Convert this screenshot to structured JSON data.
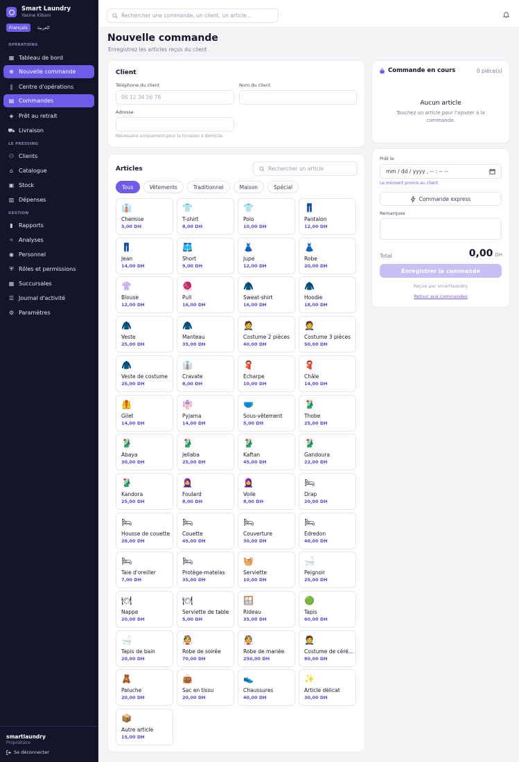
{
  "app": {
    "title": "Smart Laundry",
    "user": "Yasine Kibani",
    "languages": [
      "Français",
      "العربية"
    ]
  },
  "sidebar": {
    "sections": [
      {
        "label": "OPÉRATIONS",
        "items": [
          {
            "label": "Tableau de bord",
            "icon": "dashboard-icon"
          },
          {
            "label": "Nouvelle commande",
            "icon": "plus-circle-icon",
            "active": true
          },
          {
            "label": "Centre d'opérations",
            "icon": "kanban-icon"
          },
          {
            "label": "Commandes",
            "icon": "clipboard-icon",
            "active": true
          },
          {
            "label": "Prêt au retrait",
            "icon": "package-icon"
          },
          {
            "label": "Livraison",
            "icon": "truck-icon"
          }
        ]
      },
      {
        "label": "LE PRESSING",
        "items": [
          {
            "label": "Clients",
            "icon": "users-icon"
          },
          {
            "label": "Catalogue",
            "icon": "shirt-icon"
          },
          {
            "label": "Stock",
            "icon": "box-icon"
          },
          {
            "label": "Dépenses",
            "icon": "receipt-icon"
          }
        ]
      },
      {
        "label": "GESTION",
        "items": [
          {
            "label": "Rapports",
            "icon": "bar-chart-icon"
          },
          {
            "label": "Analyses",
            "icon": "lightbulb-icon"
          },
          {
            "label": "Personnel",
            "icon": "user-icon"
          },
          {
            "label": "Rôles et permissions",
            "icon": "shield-icon"
          },
          {
            "label": "Succursales",
            "icon": "building-icon"
          },
          {
            "label": "Journal d'activité",
            "icon": "journal-icon"
          },
          {
            "label": "Paramètres",
            "icon": "gear-icon"
          }
        ]
      }
    ],
    "footer": {
      "name": "smartlaundry",
      "role": "Propriétaire",
      "logout": "Se déconnecter"
    }
  },
  "topbar": {
    "search_placeholder": "Rechercher une commande, un client, un article..."
  },
  "page": {
    "title": "Nouvelle commande",
    "subtitle": "Enregistrez les articles reçus du client"
  },
  "client": {
    "title": "Client",
    "phone_label": "Téléphone du client",
    "phone_placeholder": "06 12 34 56 78",
    "name_label": "Nom du client",
    "name_value": "",
    "address_label": "Adresse",
    "address_value": "",
    "address_hint": "Nécessaire uniquement pour la livraison à domicile."
  },
  "articles": {
    "title": "Articles",
    "search_placeholder": "Rechercher un article",
    "filters": [
      "Tous",
      "Vêtements",
      "Traditionnel",
      "Maison",
      "Spécial"
    ],
    "active_filter": "Tous",
    "items": [
      {
        "name": "Chemise",
        "price": "5,00 DH",
        "icon": "👔"
      },
      {
        "name": "T-shirt",
        "price": "8,00 DH",
        "icon": "👕"
      },
      {
        "name": "Polo",
        "price": "10,00 DH",
        "icon": "👕"
      },
      {
        "name": "Pantalon",
        "price": "12,00 DH",
        "icon": "👖"
      },
      {
        "name": "Jean",
        "price": "14,00 DH",
        "icon": "👖"
      },
      {
        "name": "Short",
        "price": "9,00 DH",
        "icon": "🩳"
      },
      {
        "name": "Jupe",
        "price": "12,00 DH",
        "icon": "👗"
      },
      {
        "name": "Robe",
        "price": "20,00 DH",
        "icon": "👗"
      },
      {
        "name": "Blouse",
        "price": "12,00 DH",
        "icon": "👚"
      },
      {
        "name": "Pull",
        "price": "16,00 DH",
        "icon": "🧶"
      },
      {
        "name": "Sweat-shirt",
        "price": "16,00 DH",
        "icon": "🧥"
      },
      {
        "name": "Hoodie",
        "price": "18,00 DH",
        "icon": "🧥"
      },
      {
        "name": "Veste",
        "price": "25,00 DH",
        "icon": "🧥"
      },
      {
        "name": "Manteau",
        "price": "35,00 DH",
        "icon": "🧥"
      },
      {
        "name": "Costume 2 pièces",
        "price": "40,00 DH",
        "icon": "🤵"
      },
      {
        "name": "Costume 3 pièces",
        "price": "50,00 DH",
        "icon": "🤵"
      },
      {
        "name": "Veste de costume",
        "price": "25,00 DH",
        "icon": "🧥"
      },
      {
        "name": "Cravate",
        "price": "8,00 DH",
        "icon": "👔"
      },
      {
        "name": "Écharpe",
        "price": "10,00 DH",
        "icon": "🧣"
      },
      {
        "name": "Châle",
        "price": "14,00 DH",
        "icon": "🧣"
      },
      {
        "name": "Gilet",
        "price": "14,00 DH",
        "icon": "🦺"
      },
      {
        "name": "Pyjama",
        "price": "14,00 DH",
        "icon": "👘"
      },
      {
        "name": "Sous-vêtement",
        "price": "5,00 DH",
        "icon": "🩲"
      },
      {
        "name": "Thobe",
        "price": "25,00 DH",
        "icon": "🥻"
      },
      {
        "name": "Abaya",
        "price": "30,00 DH",
        "icon": "🥻"
      },
      {
        "name": "Jellaba",
        "price": "25,00 DH",
        "icon": "🥻"
      },
      {
        "name": "Kaftan",
        "price": "45,00 DH",
        "icon": "🥻"
      },
      {
        "name": "Gandoura",
        "price": "22,00 DH",
        "icon": "🥻"
      },
      {
        "name": "Kandora",
        "price": "25,00 DH",
        "icon": "🥻"
      },
      {
        "name": "Foulard",
        "price": "8,00 DH",
        "icon": "🧕"
      },
      {
        "name": "Voile",
        "price": "8,00 DH",
        "icon": "🧕"
      },
      {
        "name": "Drap",
        "price": "20,00 DH",
        "icon": "🛏"
      },
      {
        "name": "Housse de couette",
        "price": "28,00 DH",
        "icon": "🛏"
      },
      {
        "name": "Couette",
        "price": "45,00 DH",
        "icon": "🛏"
      },
      {
        "name": "Couverture",
        "price": "30,00 DH",
        "icon": "🛏"
      },
      {
        "name": "Édredon",
        "price": "40,00 DH",
        "icon": "🛏"
      },
      {
        "name": "Taie d'oreiller",
        "price": "7,00 DH",
        "icon": "🛏"
      },
      {
        "name": "Protège-matelas",
        "price": "35,00 DH",
        "icon": "🛏"
      },
      {
        "name": "Serviette",
        "price": "10,00 DH",
        "icon": "🧺"
      },
      {
        "name": "Peignoir",
        "price": "25,00 DH",
        "icon": "🛁"
      },
      {
        "name": "Nappe",
        "price": "20,00 DH",
        "icon": "🍽"
      },
      {
        "name": "Serviette de table",
        "price": "5,00 DH",
        "icon": "🍽"
      },
      {
        "name": "Rideau",
        "price": "35,00 DH",
        "icon": "🪟"
      },
      {
        "name": "Tapis",
        "price": "60,00 DH",
        "icon": "🟢"
      },
      {
        "name": "Tapis de bain",
        "price": "20,00 DH",
        "icon": "🛁"
      },
      {
        "name": "Robe de soirée",
        "price": "70,00 DH",
        "icon": "👰"
      },
      {
        "name": "Robe de mariée",
        "price": "250,00 DH",
        "icon": "👰"
      },
      {
        "name": "Costume de cérémonie",
        "price": "80,00 DH",
        "icon": "🤵"
      },
      {
        "name": "Peluche",
        "price": "20,00 DH",
        "icon": "🧸"
      },
      {
        "name": "Sac en tissu",
        "price": "20,00 DH",
        "icon": "👜"
      },
      {
        "name": "Chaussures",
        "price": "40,00 DH",
        "icon": "👟"
      },
      {
        "name": "Article délicat",
        "price": "30,00 DH",
        "icon": "✨"
      },
      {
        "name": "Autre article",
        "price": "15,00 DH",
        "icon": "📦"
      }
    ]
  },
  "order": {
    "title": "Commande en cours",
    "count": "0 pièce(s)",
    "empty_title": "Aucun article",
    "empty_sub": "Touchez un article pour l'ajouter à la commande."
  },
  "summary": {
    "ready_label": "Prêt le",
    "date_placeholder": "mm / dd / yyyy ,  -- : --   --",
    "date_hint": "Le moment promis au client.",
    "express_label": "Commande express",
    "remarks_label": "Remarques",
    "total_label": "Total",
    "total_value": "0,00",
    "currency": "DH",
    "submit_label": "Enregistrer la commande",
    "received_by": "Reçue par smartlaundry",
    "back_label": "Retour aux commandes"
  },
  "colors": {
    "accent": "#6c5ce7",
    "sidebar": "#14142b",
    "price": "#5a48d8"
  }
}
